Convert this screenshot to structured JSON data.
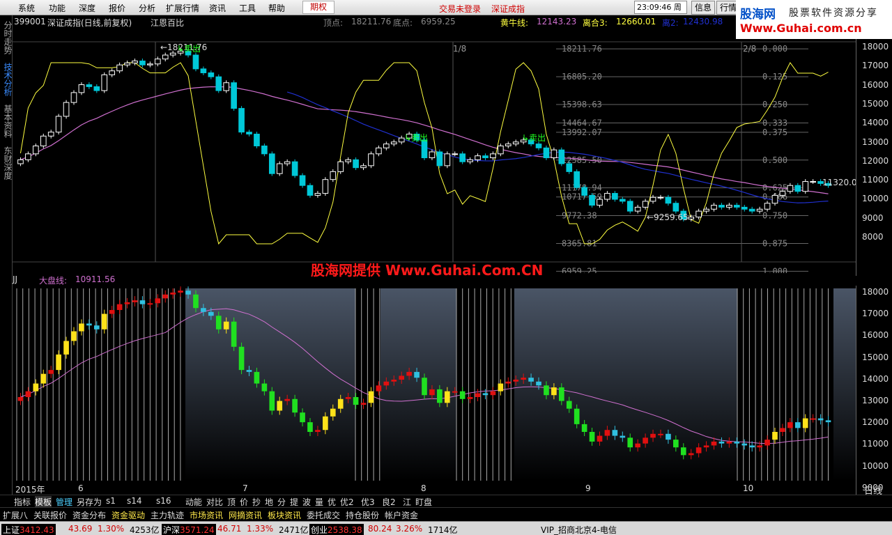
{
  "menu": {
    "items": [
      "系统",
      "功能",
      "深度",
      "报价",
      "分析",
      "扩展行情",
      "资讯",
      "工具",
      "帮助"
    ],
    "active": "期权",
    "trade_status": "交易未登录",
    "window_title": "深证成指",
    "time": "23:09:46",
    "weekday": "周六",
    "btn_info": "信息",
    "btn_quote": "行情"
  },
  "brand": {
    "name": "股海网",
    "slogan": "股票软件资源分享",
    "url": "Www.Guhai.com.cn"
  },
  "sidebar": {
    "tabs": [
      "分时走势",
      "技术分析",
      "基本资料",
      "东财深度"
    ],
    "active_index": 1
  },
  "info": {
    "code": "399001",
    "name": "深证成指(日线,前复权)",
    "method": "江恩百比",
    "top_label": "顶点:",
    "top_value": "18211.76",
    "bottom_label": "底点:",
    "bottom_value": "6959.25",
    "ind1_label": "黄牛线:",
    "ind1_value": "12143.23",
    "ind2_label": "离合3:",
    "ind2_value": "12660.01",
    "ind3_label": "离2:",
    "ind3_value": "12430.98"
  },
  "right_axis_top": [
    "18000",
    "17000",
    "16000",
    "15000",
    "14000",
    "13000",
    "12000",
    "11000",
    "10000",
    "9000",
    "8000"
  ],
  "right_axis_bottom": [
    "18000",
    "17000",
    "16000",
    "15000",
    "14000",
    "13000",
    "12000",
    "11000",
    "10000",
    "9000"
  ],
  "gann_levels": [
    {
      "price": "18211.76",
      "ratio": "0.000"
    },
    {
      "price": "16805.20",
      "ratio": "0.125"
    },
    {
      "price": "15398.63",
      "ratio": "0.250"
    },
    {
      "price": "14464.67",
      "ratio": "0.333"
    },
    {
      "price": "13992.07",
      "ratio": "0.375"
    },
    {
      "price": "12585.50",
      "ratio": "0.500"
    },
    {
      "price": "11178.94",
      "ratio": "0.625"
    },
    {
      "price": "10717.59",
      "ratio": "0.666"
    },
    {
      "price": "9772.38",
      "ratio": "0.750"
    },
    {
      "price": "8365.81",
      "ratio": "0.875"
    },
    {
      "price": "6959.25",
      "ratio": "1.000"
    }
  ],
  "annotations": {
    "high_label": "18211.76",
    "low_label": "9259.65",
    "last_label": "11320.0",
    "sell_signal": "卖出",
    "month_marks": [
      "1/8",
      "2/8"
    ]
  },
  "watermark": "股海网提供 Www.Guhai.Com.CN",
  "sub_panel": {
    "name": "JJ",
    "ind_label": "大盘线:",
    "ind_value": "10911.56"
  },
  "time_axis": {
    "year": "2015年",
    "months": [
      "6",
      "7",
      "8",
      "9",
      "10"
    ],
    "period": "日线"
  },
  "toolbar": [
    "指标",
    "模板",
    "管理",
    "另存为",
    "s1",
    "s14",
    "s16",
    "动能",
    "对比",
    "顶",
    "价",
    "抄",
    "地",
    "分",
    "提",
    "波",
    "量",
    "优",
    "优2",
    "优3",
    "良2",
    "江",
    "盯盘"
  ],
  "toolbar_active": "模板",
  "links": [
    "扩展八",
    "关联报价",
    "资金分布",
    "资金驱动",
    "主力轨迹",
    "市场资讯",
    "网摘资讯",
    "板块资讯",
    "委托成交",
    "持仓股份",
    "帐户资金"
  ],
  "status": {
    "sh_label": "上证",
    "sh_value": "3412.43",
    "sh_change": "43.69",
    "sh_pct": "1.30%",
    "sh_amount": "4253亿",
    "hs_label": "沪深",
    "hs_value": "3571.24",
    "hs_change": "46.71",
    "hs_pct": "1.33%",
    "hs_amount": "2471亿",
    "cy_label": "创业",
    "cy_value": "2538.38",
    "cy_change": "80.24",
    "cy_pct": "3.26%",
    "cy_amount": "1714亿",
    "server": "VIP_招商北京4-电信"
  },
  "colors": {
    "up": "#ffffff",
    "down": "#00c8d8",
    "ma_yellow": "#ffff40",
    "ma_blue": "#2030d0",
    "ma_pink": "#d070d0",
    "sell": "#20ff20"
  },
  "chart_data": {
    "type": "candlestick",
    "title": "深证成指(日线,前复权)",
    "ylim": [
      7500,
      18500
    ],
    "x_months": [
      "6",
      "7",
      "8",
      "9",
      "10"
    ],
    "ohlc_close": [
      12600,
      12900,
      13300,
      13800,
      14000,
      14800,
      15500,
      16000,
      16400,
      16300,
      16100,
      16900,
      17100,
      17400,
      17500,
      17600,
      17400,
      17450,
      17700,
      17900,
      18000,
      18100,
      17900,
      17200,
      17000,
      16800,
      16100,
      16500,
      15200,
      14000,
      13900,
      13300,
      12900,
      11900,
      12400,
      12500,
      11800,
      11300,
      10800,
      10900,
      11600,
      12000,
      12500,
      12600,
      12200,
      12300,
      12900,
      13200,
      13400,
      13500,
      13700,
      13900,
      13600,
      12700,
      13000,
      12300,
      12900,
      12900,
      12500,
      12600,
      12800,
      12700,
      12900,
      13300,
      13400,
      13500,
      13600,
      13400,
      13200,
      12700,
      13100,
      12400,
      12000,
      11200,
      10800,
      10300,
      10600,
      10900,
      10600,
      10500,
      10000,
      10200,
      10500,
      10700,
      10700,
      10400,
      10000,
      9600,
      9700,
      10000,
      10100,
      10300,
      10200,
      10300,
      10200,
      10100,
      10000,
      10100,
      10400,
      10800,
      11000,
      11300,
      11000,
      11500,
      11500,
      11400,
      11300
    ]
  }
}
